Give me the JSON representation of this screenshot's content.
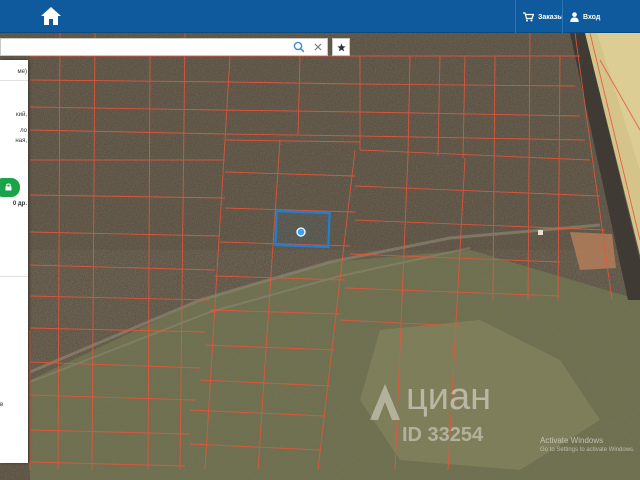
{
  "header": {
    "orders_label": "Заказы",
    "login_label": "Вход"
  },
  "search": {
    "value": ""
  },
  "panel": {
    "fragment_top": "ме)",
    "fragment_1": "кий,",
    "fragment_2": "ло",
    "fragment_3": "ная,",
    "fragment_4": "",
    "fragment_5": "0 др.",
    "fragment_6": "в"
  },
  "watermark": {
    "brand": "циан",
    "id": "ID 33254"
  },
  "os_notice": {
    "line1": "Activate Windows",
    "line2": "Go to Settings to activate Windows."
  },
  "colors": {
    "header": "#0e5a9c",
    "plot_lines": "#e8553a",
    "selected_plot": "#1e7fd6",
    "action_button": "#1aa34a"
  },
  "icons": {
    "home": "home-icon",
    "orders": "cart-icon",
    "login": "user-icon",
    "search": "search-icon",
    "clear": "close-icon",
    "favorite": "star-icon"
  }
}
